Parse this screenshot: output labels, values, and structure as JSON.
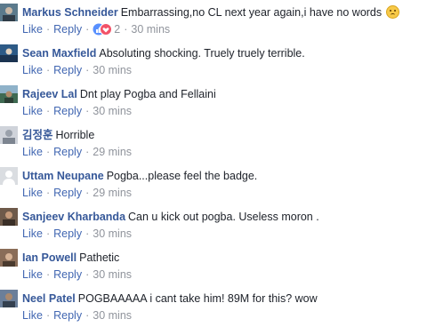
{
  "actions": {
    "like": "Like",
    "reply": "Reply",
    "separator": "·"
  },
  "comments": [
    {
      "author": "Markus Schneider",
      "text": "Embarrassing,no CL next year again,i have no words",
      "reaction_count": "2",
      "time": "30 mins",
      "has_emoji": true,
      "has_reactions": true,
      "avatar_color": "#5b7a8c",
      "colors": {
        "avatar": "#5b7a8c"
      }
    },
    {
      "author": "Sean Maxfield",
      "text": "Absoluting shocking. Truely truely terrible.",
      "time": "30 mins",
      "avatar_color": "#2d5a86",
      "colors": {
        "avatar": "#2d5a86"
      }
    },
    {
      "author": "Rajeev Lal",
      "text": "Dnt play Pogba and Fellaini",
      "time": "30 mins",
      "avatar_color": "#3f6a52",
      "colors": {
        "avatar": "#3f6a52"
      }
    },
    {
      "author": "김정훈",
      "text": "Horrible",
      "time": "29 mins",
      "avatar_color": "#cfd3da",
      "colors": {
        "avatar": "#cfd3da"
      }
    },
    {
      "author": "Uttam Neupane",
      "text": "Pogba...please feel the badge.",
      "time": "29 mins",
      "avatar_color": "#dadde1",
      "colors": {
        "avatar": "#dadde1"
      }
    },
    {
      "author": "Sanjeev Kharbanda",
      "text": "Can u kick out pogba. Useless moron .",
      "time": "30 mins",
      "avatar_color": "#6e5a4a",
      "colors": {
        "avatar": "#6e5a4a"
      }
    },
    {
      "author": "Ian Powell",
      "text": "Pathetic",
      "time": "30 mins",
      "avatar_color": "#8a6d58",
      "colors": {
        "avatar": "#8a6d58"
      }
    },
    {
      "author": "Neel Patel",
      "text": "POGBAAAAA i cant take him! 89M for this? wow",
      "time": "30 mins",
      "avatar_color": "#6b7f9a",
      "colors": {
        "avatar": "#6b7f9a"
      }
    }
  ]
}
